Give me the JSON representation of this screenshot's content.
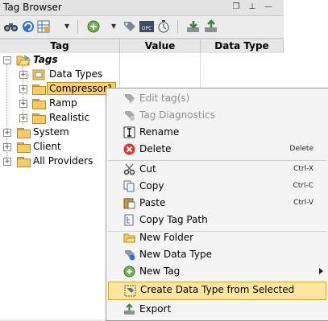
{
  "window": {
    "title": "Tag Browser"
  },
  "toolbar": {
    "buttons": [
      "binoculars-icon",
      "refresh-icon",
      "table-icon",
      "add-icon",
      "tag-icon",
      "opc-icon",
      "timer-icon",
      "import-icon",
      "export-icon"
    ],
    "opc_text": "OPC"
  },
  "table": {
    "columns": [
      "Tag",
      "Value",
      "Data Type"
    ]
  },
  "tree": {
    "root": "Tags",
    "children": [
      "Data Types",
      "Compressor1",
      "Ramp",
      "Realistic"
    ],
    "top_level": [
      "System",
      "Client",
      "All Providers"
    ]
  },
  "menu": {
    "items": [
      {
        "label": "Edit tag(s)",
        "shortcut": "",
        "disabled": true
      },
      {
        "label": "Tag Diagnostics",
        "shortcut": "",
        "disabled": true
      },
      {
        "label": "Rename",
        "shortcut": ""
      },
      {
        "label": "Delete",
        "shortcut": "Delete"
      },
      {
        "label": "Cut",
        "shortcut": "Ctrl-X"
      },
      {
        "label": "Copy",
        "shortcut": "Ctrl-C"
      },
      {
        "label": "Paste",
        "shortcut": "Ctrl-V"
      },
      {
        "label": "Copy Tag Path",
        "shortcut": ""
      },
      {
        "label": "New Folder",
        "shortcut": ""
      },
      {
        "label": "New Data Type",
        "shortcut": ""
      },
      {
        "label": "New Tag",
        "shortcut": ""
      },
      {
        "label": "Create Data Type from Selected",
        "shortcut": ""
      },
      {
        "label": "Export",
        "shortcut": ""
      }
    ]
  },
  "colors": {
    "selection": "#f7cf76",
    "menu_highlight": "#fde7a0",
    "folder": "#f3cd62"
  }
}
